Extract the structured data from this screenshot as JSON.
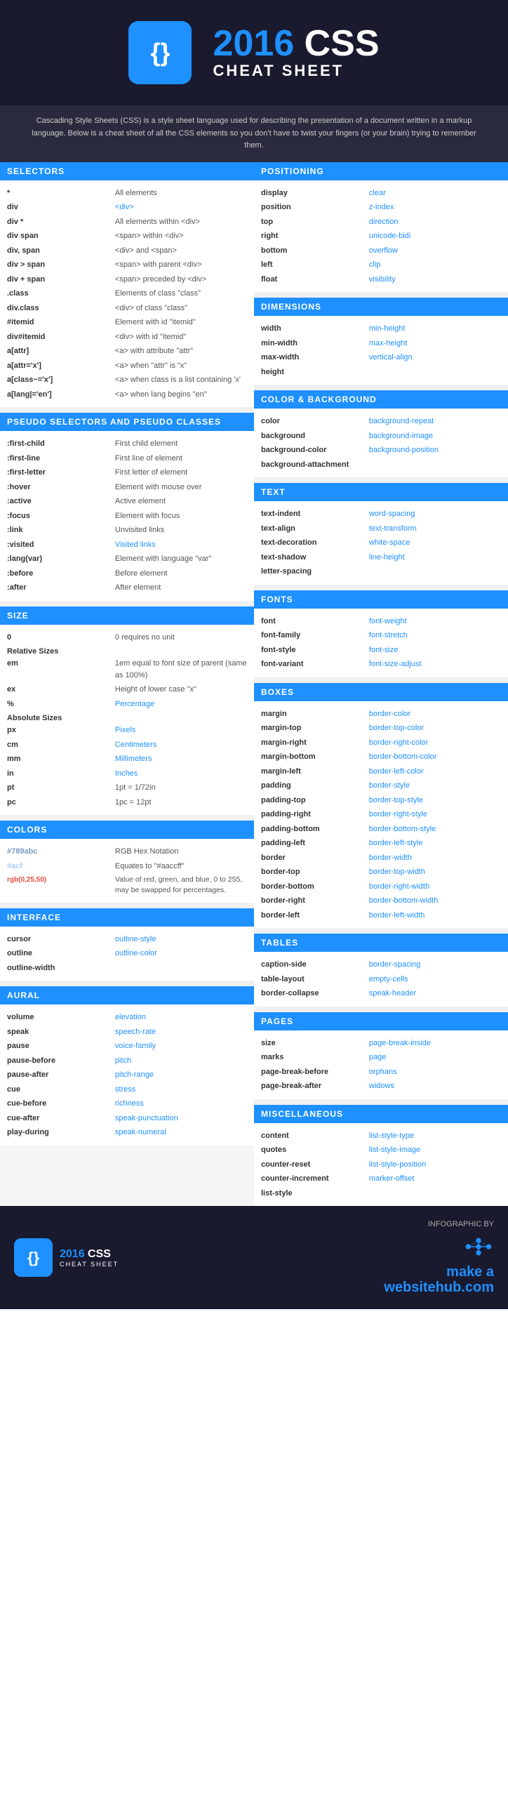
{
  "header": {
    "year": "2016",
    "css_label": "CSS",
    "title": "CHEAT SHEET",
    "description": "Cascading Style Sheets (CSS) is a style sheet language used for describing the presentation of a document written in a markup language. Below is a cheat sheet of all the CSS elements so you don't have to twist your fingers (or your brain) trying to remember them.",
    "logo_symbol": "{}"
  },
  "sections": {
    "selectors": {
      "header": "SELECTORS",
      "rows": [
        {
          "label": "*",
          "value": "All elements"
        },
        {
          "label": "div",
          "value": "<div>"
        },
        {
          "label": "div *",
          "value": "All elements within <div>"
        },
        {
          "label": "div span",
          "value": "<span> within <div>"
        },
        {
          "label": "div, span",
          "value": "<div> and <span>"
        },
        {
          "label": "div > span",
          "value": "<span> with parent <div>"
        },
        {
          "label": "div + span",
          "value": "<span> preceded by <div>"
        },
        {
          "label": ".class",
          "value": "Elements of class \"class\""
        },
        {
          "label": "div.class",
          "value": "<div> of class \"class\""
        },
        {
          "label": "#itemid",
          "value": "Element with id \"itemid\""
        },
        {
          "label": "div#itemid",
          "value": "<div> with id \"itemid\""
        },
        {
          "label": "a[attr]",
          "value": "<a> with attribute \"attr\""
        },
        {
          "label": "a[attr='x']",
          "value": "<a> when \"attr\" is \"x\""
        },
        {
          "label": "a[class~='x']",
          "value": "<a> when class is a list containing 'x'"
        },
        {
          "label": "a[lang|='en']",
          "value": "<a> when lang begins \"en\""
        }
      ]
    },
    "pseudo": {
      "header": "PSEUDO SELECTORS AND PSEUDO CLASSES",
      "rows": [
        {
          "label": ":first-child",
          "value": "First child element"
        },
        {
          "label": ":first-line",
          "value": "First line of element"
        },
        {
          "label": ":first-letter",
          "value": "First letter of element"
        },
        {
          "label": ":hover",
          "value": "Element with mouse over"
        },
        {
          "label": ":active",
          "value": "Active element"
        },
        {
          "label": ":focus",
          "value": "Element with focus"
        },
        {
          "label": ":link",
          "value": "Unvisited links"
        },
        {
          "label": ":visited",
          "value": "Visited links"
        },
        {
          "label": ":lang(var)",
          "value": "Element with language \"var\""
        },
        {
          "label": ":before",
          "value": "Before element"
        },
        {
          "label": ":after",
          "value": "After element"
        }
      ]
    },
    "size": {
      "header": "SIZE",
      "rows": [
        {
          "label": "0",
          "value": "0 requires no unit",
          "type": "normal"
        },
        {
          "sublabel": "Relative Sizes"
        },
        {
          "label": "em",
          "value": "1em equal to font size of parent (same as 100%)"
        },
        {
          "label": "ex",
          "value": "Height of lower case \"x\""
        },
        {
          "label": "%",
          "value": "Percentage"
        },
        {
          "sublabel": "Absolute Sizes"
        },
        {
          "label": "px",
          "value": "Pixels"
        },
        {
          "label": "cm",
          "value": "Centimeters"
        },
        {
          "label": "mm",
          "value": "Millimeters"
        },
        {
          "label": "in",
          "value": "Inches"
        },
        {
          "label": "pt",
          "value": "1pt = 1/72in"
        },
        {
          "label": "pc",
          "value": "1pc = 12pt"
        }
      ]
    },
    "colors": {
      "header": "COLORS",
      "rows": [
        {
          "label": "#789abc",
          "value": "RGB Hex Notation",
          "labelcolor": "normal"
        },
        {
          "label": "#acf",
          "value": "Equates to \"#aaccff\""
        },
        {
          "label": "rgb(0,25,50)",
          "value": "Value of red, green, and blue, 0 to 255, may be swapped for percentages."
        }
      ]
    },
    "interface": {
      "header": "INTERFACE",
      "rows": [
        {
          "label": "cursor",
          "value": "outline-style"
        },
        {
          "label": "outline",
          "value": "outline-color"
        },
        {
          "label": "outline-width",
          "value": ""
        }
      ]
    },
    "aural": {
      "header": "AURAL",
      "rows": [
        {
          "label": "volume",
          "value": "elevation"
        },
        {
          "label": "speak",
          "value": "speech-rate"
        },
        {
          "label": "pause",
          "value": "voice-family"
        },
        {
          "label": "pause-before",
          "value": "pitch"
        },
        {
          "label": "pause-after",
          "value": "pitch-range"
        },
        {
          "label": "cue",
          "value": "stress"
        },
        {
          "label": "cue-before",
          "value": "richness"
        },
        {
          "label": "cue-after",
          "value": "speak-punctuation"
        },
        {
          "label": "play-during",
          "value": "speak-numeral"
        }
      ]
    },
    "positioning": {
      "header": "POSITIONING",
      "rows": [
        {
          "label": "display",
          "value": "clear"
        },
        {
          "label": "position",
          "value": "z-index"
        },
        {
          "label": "top",
          "value": "direction"
        },
        {
          "label": "right",
          "value": "unicode-bidi"
        },
        {
          "label": "bottom",
          "value": "overflow"
        },
        {
          "label": "left",
          "value": "clip"
        },
        {
          "label": "float",
          "value": "visibility"
        }
      ]
    },
    "dimensions": {
      "header": "DIMENSIONS",
      "rows": [
        {
          "label": "width",
          "value": "min-height"
        },
        {
          "label": "min-width",
          "value": "max-height"
        },
        {
          "label": "max-width",
          "value": "vertical-align"
        },
        {
          "label": "height",
          "value": ""
        }
      ]
    },
    "color_background": {
      "header": "COLOR & BACKGROUND",
      "rows": [
        {
          "label": "color",
          "value": "background-repeat"
        },
        {
          "label": "background",
          "value": "background-image"
        },
        {
          "label": "background-color",
          "value": "background-position"
        },
        {
          "label": "background-attachment",
          "value": ""
        }
      ]
    },
    "text": {
      "header": "TEXT",
      "rows": [
        {
          "label": "text-indent",
          "value": "word-spacing"
        },
        {
          "label": "text-align",
          "value": "text-transform"
        },
        {
          "label": "text-decoration",
          "value": "white-space"
        },
        {
          "label": "text-shadow",
          "value": "line-height"
        },
        {
          "label": "letter-spacing",
          "value": ""
        }
      ]
    },
    "fonts": {
      "header": "FONTS",
      "rows": [
        {
          "label": "font",
          "value": "font-weight"
        },
        {
          "label": "font-family",
          "value": "font-stretch"
        },
        {
          "label": "font-style",
          "value": "font-size"
        },
        {
          "label": "font-variant",
          "value": "font-size-adjust"
        }
      ]
    },
    "boxes": {
      "header": "BOXES",
      "rows": [
        {
          "label": "margin",
          "value": "border-color"
        },
        {
          "label": "margin-top",
          "value": "border-top-color"
        },
        {
          "label": "margin-right",
          "value": "border-right-color"
        },
        {
          "label": "margin-bottom",
          "value": "border-bottom-color"
        },
        {
          "label": "margin-left",
          "value": "border-left-color"
        },
        {
          "label": "padding",
          "value": "border-style"
        },
        {
          "label": "padding-top",
          "value": "border-top-style"
        },
        {
          "label": "padding-right",
          "value": "border-right-style"
        },
        {
          "label": "padding-bottom",
          "value": "border-bottom-style"
        },
        {
          "label": "padding-left",
          "value": "border-left-style"
        },
        {
          "label": "border",
          "value": "border-width"
        },
        {
          "label": "border-top",
          "value": "border-top-width"
        },
        {
          "label": "border-bottom",
          "value": "border-right-width"
        },
        {
          "label": "border-right",
          "value": "border-bottom-width"
        },
        {
          "label": "border-left",
          "value": "border-left-width"
        }
      ]
    },
    "tables": {
      "header": "TABLES",
      "rows": [
        {
          "label": "caption-side",
          "value": "border-spacing"
        },
        {
          "label": "table-layout",
          "value": "empty-cells"
        },
        {
          "label": "border-collapse",
          "value": "speak-header"
        }
      ]
    },
    "pages": {
      "header": "PAGES",
      "rows": [
        {
          "label": "size",
          "value": "page-break-inside"
        },
        {
          "label": "marks",
          "value": "page"
        },
        {
          "label": "page-break-before",
          "value": "orphans"
        },
        {
          "label": "page-break-after",
          "value": "widows"
        }
      ]
    },
    "miscellaneous": {
      "header": "MISCELLANEOUS",
      "rows": [
        {
          "label": "content",
          "value": "list-style-type"
        },
        {
          "label": "quotes",
          "value": "list-style-image"
        },
        {
          "label": "counter-reset",
          "value": "list-style-position"
        },
        {
          "label": "counter-increment",
          "value": "marker-offset"
        },
        {
          "label": "list-style",
          "value": ""
        }
      ]
    }
  },
  "footer": {
    "logo_symbol": "{}",
    "year": "2016",
    "css_label": "CSS",
    "title": "CHEAT SHEET",
    "infographic_by": "INFOGRAPHIC BY",
    "make": "make a",
    "site": "websitehub.com"
  }
}
